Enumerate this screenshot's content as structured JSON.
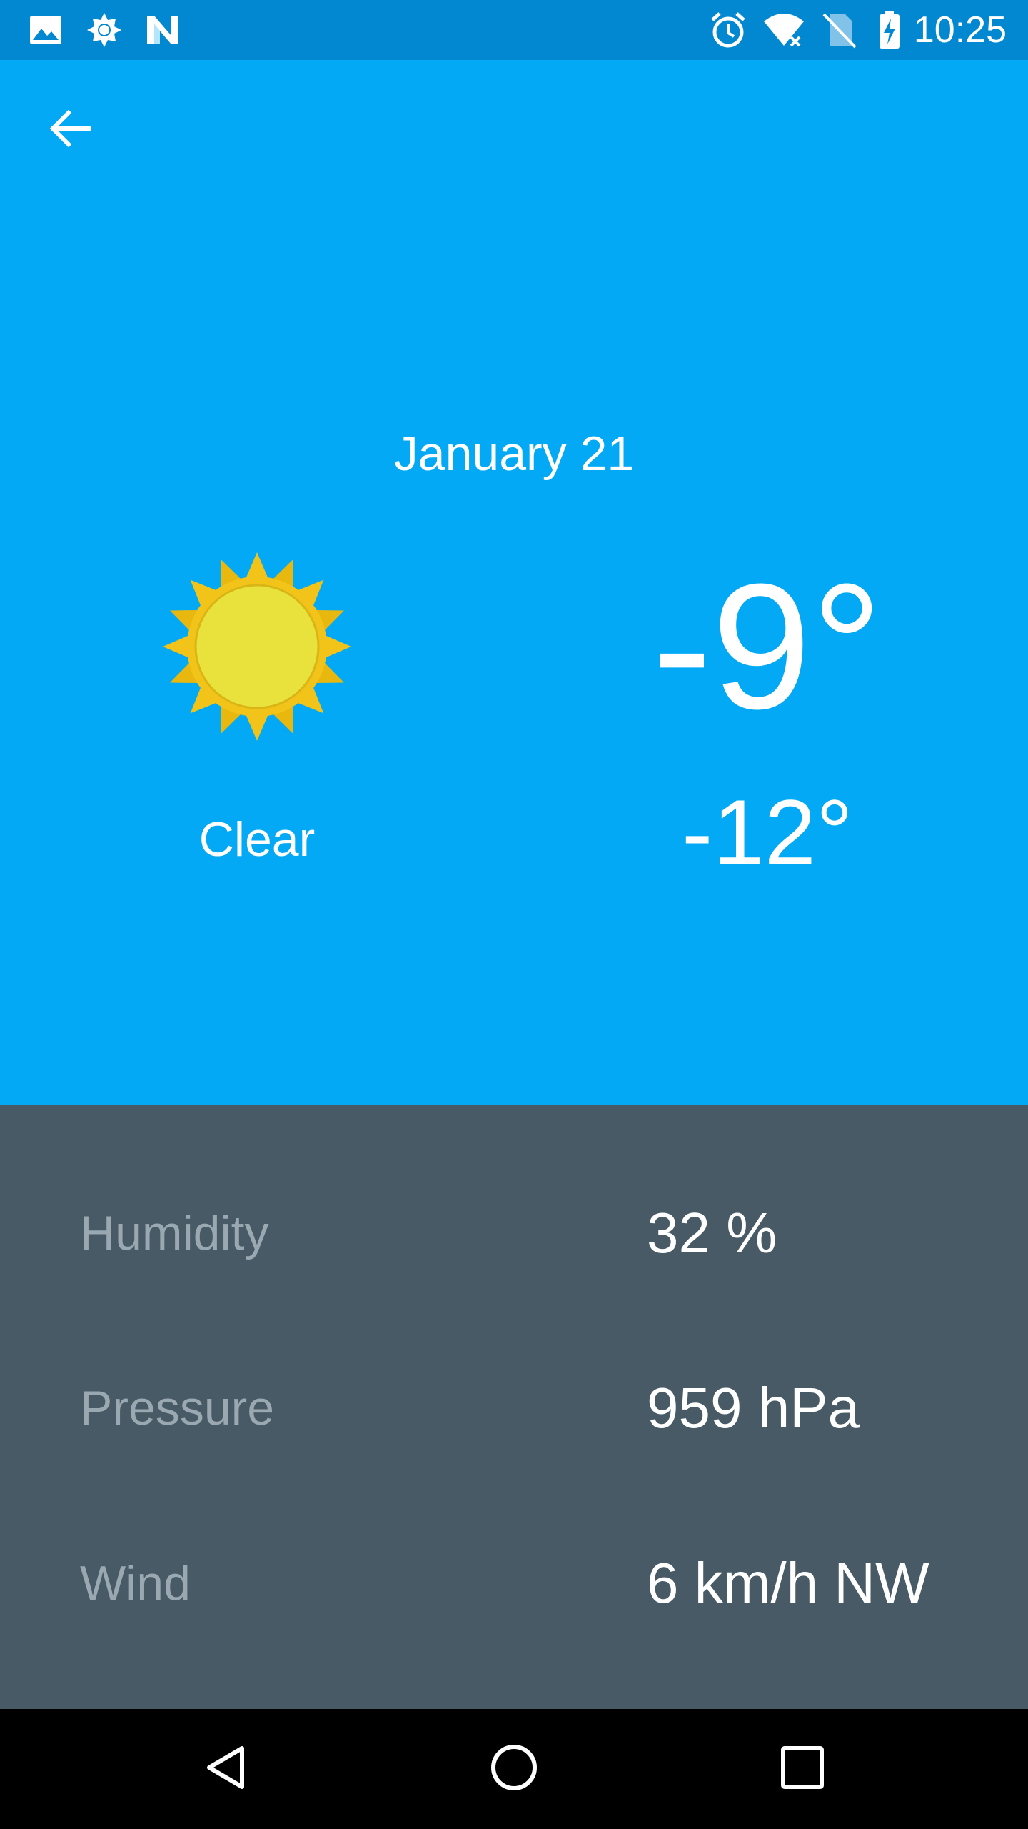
{
  "status_bar": {
    "time": "10:25",
    "icons_left": [
      "image-icon",
      "brightness-icon",
      "n-logo-icon"
    ],
    "icons_right": [
      "alarm-icon",
      "wifi-icon",
      "no-sim-icon",
      "battery-charging-icon"
    ]
  },
  "weather": {
    "date": "January 21",
    "condition": "Clear",
    "condition_icon": "sun-icon",
    "high": "-9°",
    "low": "-12°"
  },
  "details": [
    {
      "label": "Humidity",
      "value": "32 %"
    },
    {
      "label": "Pressure",
      "value": "959 hPa"
    },
    {
      "label": "Wind",
      "value": "6 km/h NW"
    }
  ],
  "navigation": {
    "back": "back-arrow-icon",
    "buttons": [
      "nav-back-icon",
      "nav-home-icon",
      "nav-recents-icon"
    ]
  },
  "colors": {
    "primary": "#03A9F4",
    "primary_dark": "#0288D1",
    "details_bg": "#485A66",
    "sun_outer": "#F2C318",
    "sun_inner": "#E9E23C"
  }
}
